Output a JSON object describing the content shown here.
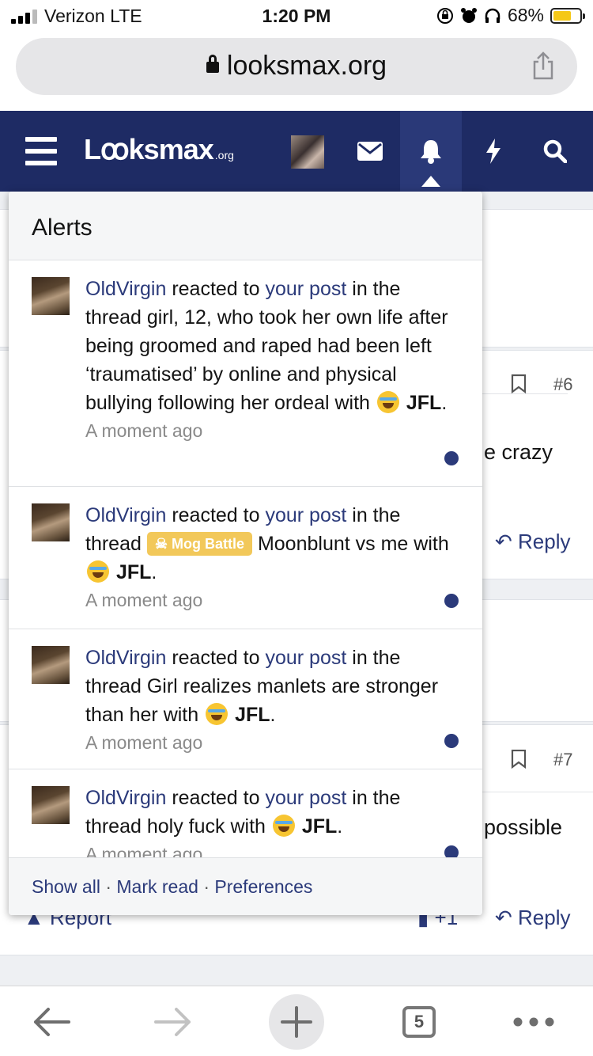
{
  "status_bar": {
    "carrier": "Verizon  LTE",
    "time": "1:20 PM",
    "battery": "68%",
    "battery_fraction": 0.68
  },
  "browser": {
    "url": "looksmax.org"
  },
  "nav": {
    "logo_main": "Lꝏksmax",
    "logo_tld": ".org",
    "active_item": "alerts"
  },
  "background": {
    "post_number_1": "#6",
    "snippet_1": "e crazy",
    "reply_label_1": "Reply",
    "post_number_2": "#7",
    "snippet_2": "possible",
    "report_label": "Report",
    "like_count": "+1",
    "reply_label_2": "Reply"
  },
  "alerts": {
    "title": "Alerts",
    "items": [
      {
        "user": "OldVirgin",
        "action": "reacted to",
        "target": "your post",
        "in_thread": "in the thread",
        "thread_prefix": "",
        "thread": "girl, 12, who took her own life after being groomed and raped had been left ‘traumatised’ by online and physical bullying following her ordeal",
        "with_text": "with",
        "reaction": "JFL",
        "time": "A moment ago"
      },
      {
        "user": "OldVirgin",
        "action": "reacted to",
        "target": "your post",
        "in_thread": "in the thread",
        "thread_prefix": "Mog Battle",
        "thread": "Moonblunt vs me",
        "with_text": "with",
        "reaction": "JFL",
        "time": "A moment ago"
      },
      {
        "user": "OldVirgin",
        "action": "reacted to",
        "target": "your post",
        "in_thread": "in the thread",
        "thread_prefix": "",
        "thread": "Girl realizes manlets are stronger than her",
        "with_text": "with",
        "reaction": "JFL",
        "time": "A moment ago"
      },
      {
        "user": "OldVirgin",
        "action": "reacted to",
        "target": "your post",
        "in_thread": "in the thread",
        "thread_prefix": "",
        "thread": "holy fuck",
        "with_text": "with",
        "reaction": "JFL",
        "time": "A moment ago"
      }
    ],
    "footer": {
      "show_all": "Show all",
      "separator": "·",
      "mark_read": "Mark read",
      "preferences": "Preferences"
    }
  },
  "toolbar": {
    "tab_count": "5"
  },
  "colors": {
    "nav_bg": "#1e2b64",
    "link": "#2b3a7a",
    "prefix_badge": "#f2c85a",
    "battery": "#f5c817"
  },
  "icons": [
    "menu-icon",
    "envelope-icon",
    "bell-icon",
    "bolt-icon",
    "search-icon",
    "share-icon",
    "lock-icon",
    "back-icon",
    "forward-icon",
    "plus-icon",
    "more-icon",
    "bookmark-icon",
    "reply-icon",
    "thumbs-up-icon",
    "skull-icon",
    "laughing-crying-emoji-icon"
  ]
}
